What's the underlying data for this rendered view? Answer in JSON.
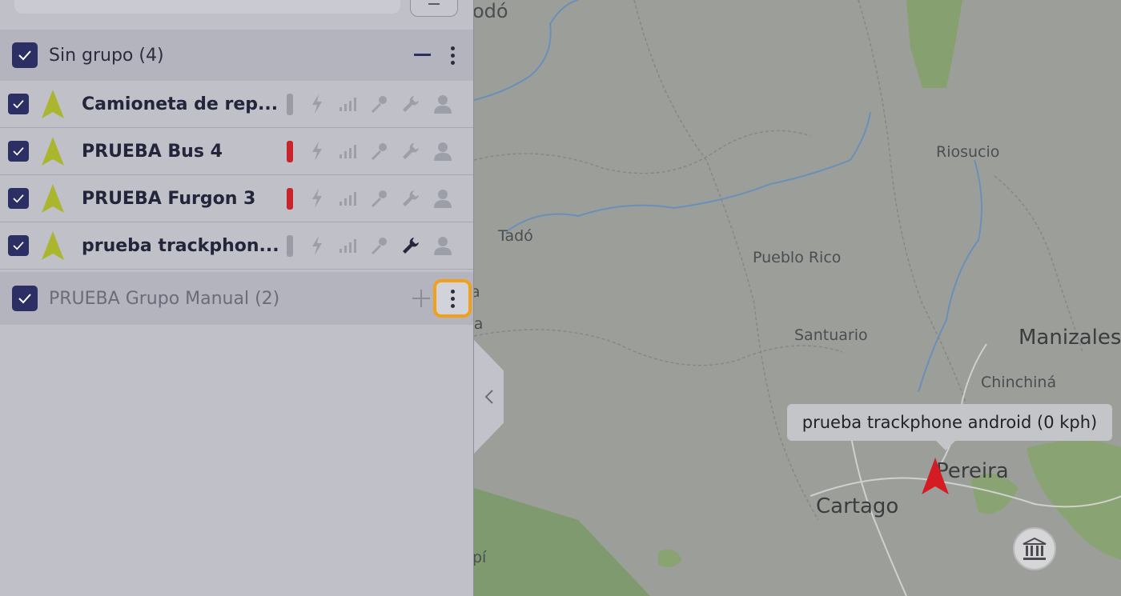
{
  "sidebar": {
    "groups": [
      {
        "title": "Sin grupo (4)",
        "devices": [
          {
            "name": "Camioneta de rep...",
            "status_color": "#9a9ba5"
          },
          {
            "name": "PRUEBA Bus 4",
            "status_color": "#c9242b"
          },
          {
            "name": "PRUEBA Furgon 3",
            "status_color": "#c9242b"
          },
          {
            "name": "prueba trackphon...",
            "status_color": "#9a9ba5"
          }
        ]
      },
      {
        "title": "PRUEBA Grupo Manual (2)"
      }
    ]
  },
  "map": {
    "places": [
      "odó",
      "Riosucio",
      "Tadó",
      "Pueblo Rico",
      "a",
      "ra",
      "Santuario",
      "Manizales",
      "Chinchiná",
      "Pereira",
      "Cartago",
      "pí"
    ],
    "tooltip": "prueba trackphone android (0 kph)"
  },
  "colors": {
    "accent": "#2b2f63",
    "highlight": "#f2a01a",
    "marker": "#d41c24",
    "status_off": "#9a9ba5",
    "status_alert": "#c9242b"
  }
}
